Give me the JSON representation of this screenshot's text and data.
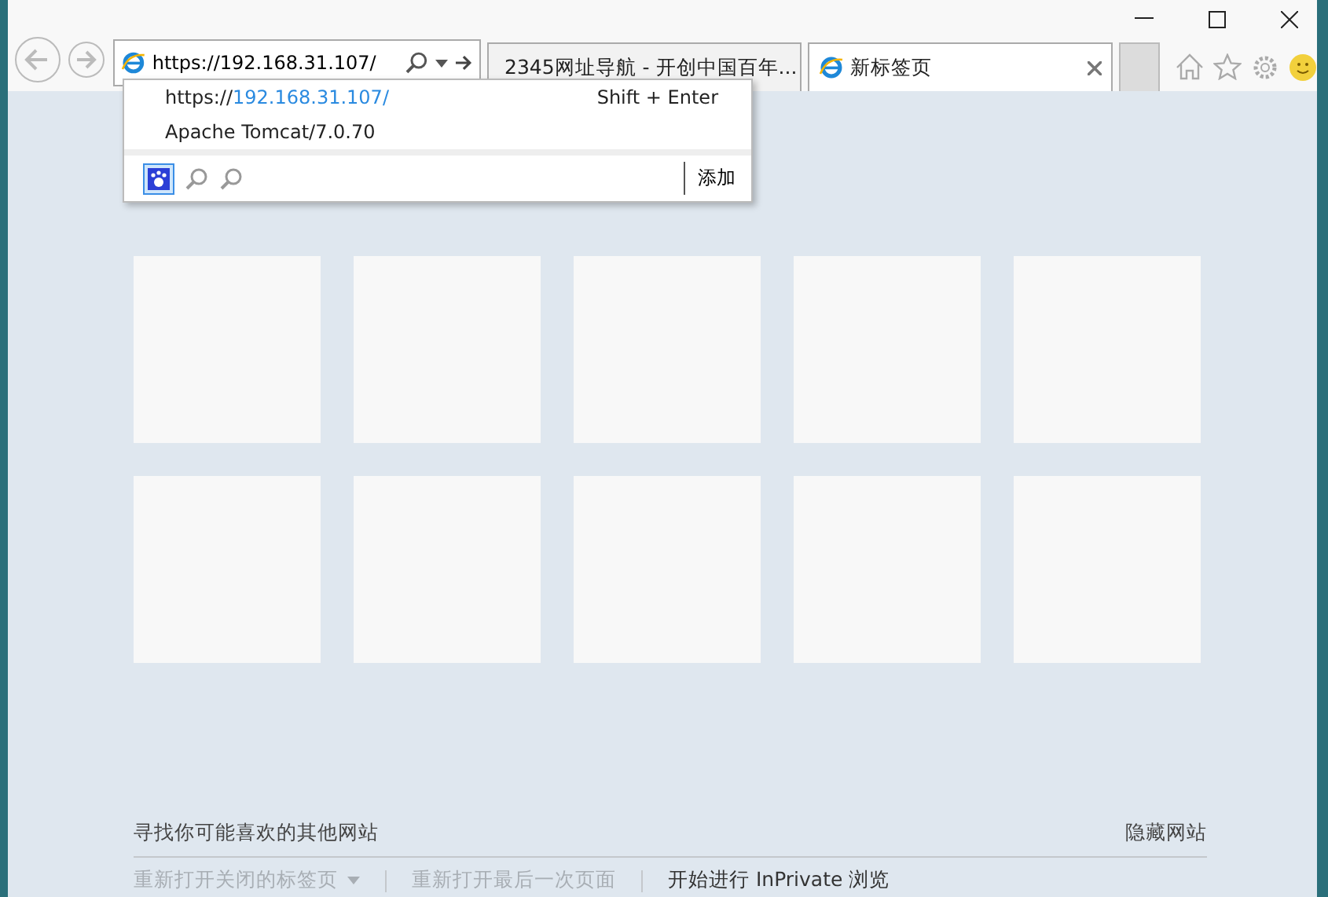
{
  "address_bar": {
    "value": "https://192.168.31.107/"
  },
  "tabs": [
    {
      "title": "2345网址导航 - 开创中国百年...",
      "selected": false
    },
    {
      "title": "新标签页",
      "selected": true
    }
  ],
  "suggestions": {
    "items": [
      {
        "host": "https://",
        "rest": "192.168.31.107/",
        "hint": "Shift + Enter"
      },
      {
        "host": "Apache Tomcat/7.0.70"
      }
    ],
    "add_label": "添加"
  },
  "tiles": [
    {
      "kind": "empty"
    },
    {
      "kind": "empty"
    },
    {
      "kind": "empty"
    },
    {
      "kind": "empty"
    },
    {
      "kind": "empty"
    },
    {
      "kind": "empty"
    },
    {
      "kind": "empty"
    },
    {
      "kind": "empty"
    },
    {
      "kind": "empty"
    },
    {
      "kind": "empty"
    }
  ],
  "footer": {
    "discover": "寻找你可能喜欢的其他网站",
    "hide": "隐藏网站",
    "actions": [
      {
        "label": "重新打开关闭的标签页",
        "disabled": true,
        "dropdown": true
      },
      {
        "label": "重新打开最后一次页面",
        "disabled": true,
        "dropdown": false
      },
      {
        "label": "开始进行 InPrivate 浏览",
        "disabled": false,
        "dropdown": false
      }
    ]
  }
}
